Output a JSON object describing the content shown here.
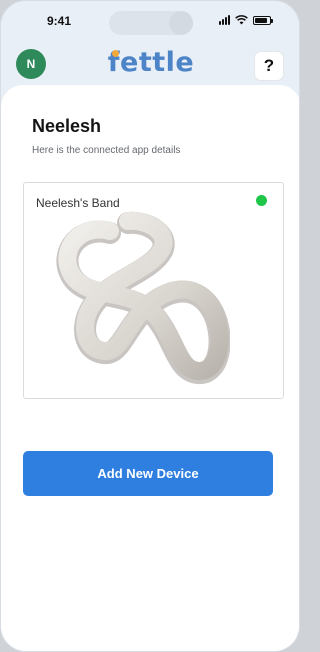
{
  "status_bar": {
    "time": "9:41",
    "signal_icon": "cellular-signal-icon",
    "wifi_icon": "wifi-icon",
    "battery_icon": "battery-icon",
    "battery_level": 0.85
  },
  "header": {
    "avatar_initial": "N",
    "avatar_color": "#2f8a5b",
    "logo_text": "fettle",
    "logo_color": "#4c84c7",
    "logo_accent_color": "#f2a93b",
    "help_label": "?"
  },
  "main": {
    "user_name": "Neelesh",
    "subtitle": "Here is the connected app details",
    "device": {
      "name": "Neelesh's Band",
      "status": "connected",
      "status_color": "#1fc64a",
      "image_icon": "infinity-band-icon"
    },
    "add_device_label": "Add New Device",
    "accent_color": "#2f7fe0"
  }
}
